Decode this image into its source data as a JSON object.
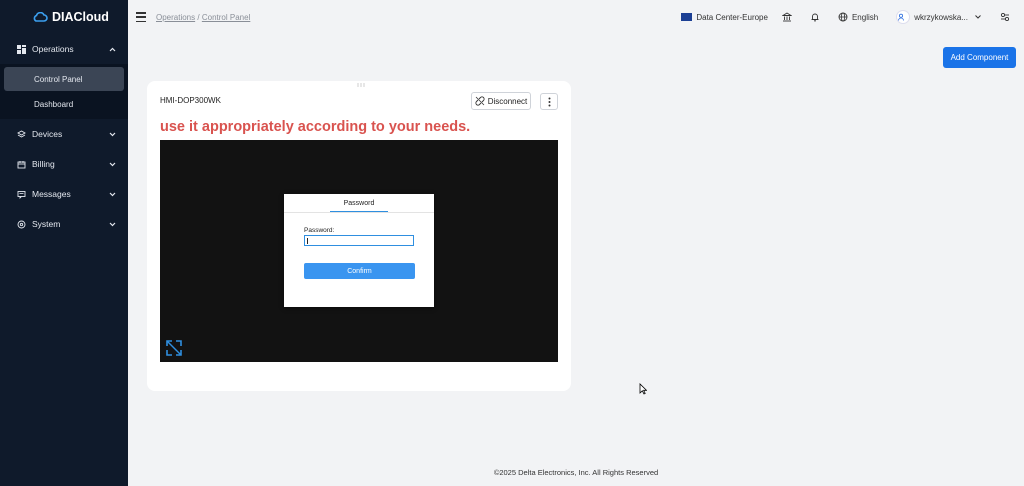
{
  "app": {
    "name": "DIACloud"
  },
  "sidebar": {
    "groups": [
      {
        "label": "Operations",
        "icon": "grid-icon",
        "expanded": true,
        "items": [
          {
            "label": "Control Panel",
            "active": true
          },
          {
            "label": "Dashboard",
            "active": false
          }
        ]
      },
      {
        "label": "Devices",
        "icon": "layers-icon",
        "expanded": false
      },
      {
        "label": "Billing",
        "icon": "calendar-icon",
        "expanded": false
      },
      {
        "label": "Messages",
        "icon": "message-icon",
        "expanded": false
      },
      {
        "label": "System",
        "icon": "settings-icon",
        "expanded": false
      }
    ]
  },
  "breadcrumb": {
    "root": "Operations",
    "separator": "/",
    "current": "Control Panel"
  },
  "topbar": {
    "datacenter": "Data Center-Europe",
    "language": "English",
    "user": "wkrzykowska..."
  },
  "actions": {
    "add_component": "Add Component"
  },
  "card": {
    "title": "HMI-DOP300WK",
    "disconnect_label": "Disconnect",
    "notice": "use it appropriately according to your needs.",
    "dialog": {
      "tab": "Password",
      "field_label": "Password:",
      "confirm_label": "Confirm"
    }
  },
  "footer": {
    "text": "©2025 Delta Electronics, Inc. All Rights Reserved"
  },
  "colors": {
    "sidebar_bg": "#0f1a2b",
    "accent": "#1a73e8",
    "notice": "#d9534f"
  }
}
